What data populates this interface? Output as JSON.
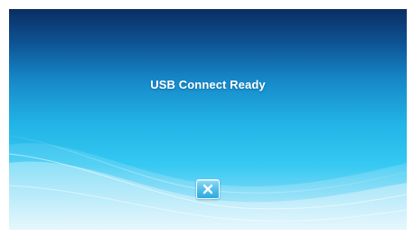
{
  "dialog": {
    "message": "USB Connect Ready",
    "close_icon": "close-icon"
  },
  "colors": {
    "background_top": "#0a2e63",
    "background_mid": "#22b4e6",
    "background_bottom": "#cdeefb",
    "text": "#ffffff"
  }
}
